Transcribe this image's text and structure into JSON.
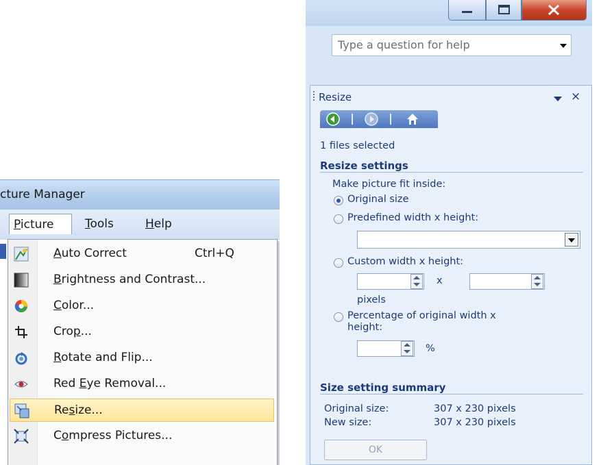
{
  "left_window": {
    "title_fragment": "cture Manager",
    "menubar": [
      {
        "label": "Picture",
        "accel": "P",
        "rest": "icture",
        "open": true
      },
      {
        "label": "Tools",
        "accel": "T",
        "rest": "ools"
      },
      {
        "label": "Help",
        "accel": "H",
        "rest": "elp"
      }
    ],
    "menu_items": [
      {
        "pre": "",
        "accel": "A",
        "post": "uto Correct",
        "shortcut": "Ctrl+Q",
        "icon": "auto-correct-icon"
      },
      {
        "pre": "",
        "accel": "B",
        "post": "rightness and Contrast...",
        "shortcut": "",
        "icon": "brightness-contrast-icon"
      },
      {
        "pre": "",
        "accel": "C",
        "post": "olor...",
        "shortcut": "",
        "icon": "color-wheel-icon"
      },
      {
        "pre": "Cro",
        "accel": "p",
        "post": "...",
        "shortcut": "",
        "icon": "crop-icon"
      },
      {
        "pre": "",
        "accel": "R",
        "post": "otate and Flip...",
        "shortcut": "",
        "icon": "rotate-flip-icon"
      },
      {
        "pre": "Red ",
        "accel": "E",
        "post": "ye Removal...",
        "shortcut": "",
        "icon": "red-eye-icon"
      },
      {
        "pre": "Re",
        "accel": "s",
        "post": "ize...",
        "shortcut": "",
        "icon": "resize-icon",
        "highlighted": true
      },
      {
        "pre": "C",
        "accel": "o",
        "post": "mpress Pictures...",
        "shortcut": "",
        "icon": "compress-icon"
      }
    ]
  },
  "right_window": {
    "help_placeholder": "Type a question for help",
    "pane": {
      "title": "Resize",
      "files_selected": "1 files selected",
      "resize_settings_heading": "Resize settings",
      "fit_label": "Make picture fit inside:",
      "options": {
        "original": "Original size",
        "predefined": "Predefined width x height:",
        "custom": "Custom width x height:",
        "percentage_line1": "Percentage of original width x",
        "percentage_line2": "height:"
      },
      "selected_option": "original",
      "times_symbol": "x",
      "pixels_label": "pixels",
      "percent_symbol": "%",
      "summary_heading": "Size setting summary",
      "original_size_label": "Original size:",
      "original_size_value": "307 x 230 pixels",
      "new_size_label": "New size:",
      "new_size_value": "307 x 230 pixels",
      "ok_label": "OK"
    }
  }
}
